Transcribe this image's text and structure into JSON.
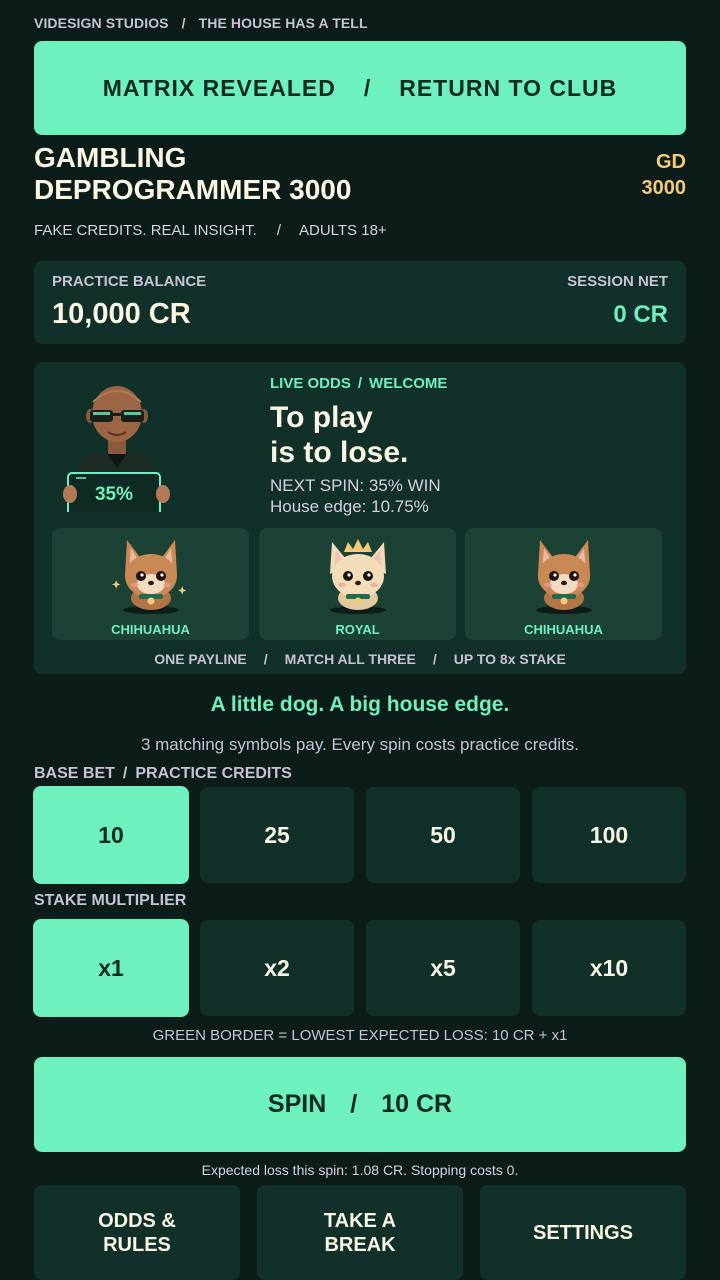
{
  "breadcrumb": {
    "studio": "VIDESIGN STUDIOS",
    "sep": "/",
    "game": "THE HOUSE HAS A TELL"
  },
  "top_button": {
    "left": "MATRIX REVEALED",
    "sep": "/",
    "right": "RETURN TO CLUB"
  },
  "header": {
    "title_line1": "GAMBLING",
    "title_line2": "DEPROGRAMMER 3000",
    "badge_line1": "GD",
    "badge_line2": "3000",
    "sub_left": "FAKE CREDITS. REAL INSIGHT.",
    "sub_sep": "/",
    "sub_right": "ADULTS 18+"
  },
  "balance": {
    "label": "PRACTICE BALANCE",
    "value": "10,000 CR",
    "net_label": "SESSION NET",
    "net_value": "0 CR"
  },
  "dealer": {
    "sign": "35%"
  },
  "odds": {
    "label": "LIVE ODDS",
    "sep": "/",
    "label2": "WELCOME",
    "headline1": "To play",
    "headline2": "is to lose.",
    "next_spin": "NEXT SPIN: 35% WIN",
    "house_edge": "House edge: 10.75%"
  },
  "reels": [
    {
      "label": "CHIHUAHUA",
      "icon": "chihuahua-icon"
    },
    {
      "label": "ROYAL",
      "icon": "royal-chihuahua-icon"
    },
    {
      "label": "CHIHUAHUA",
      "icon": "chihuahua-icon"
    }
  ],
  "payline": {
    "a": "ONE PAYLINE",
    "sep": "/",
    "b": "MATCH ALL THREE",
    "c": "UP TO 8x STAKE"
  },
  "tagline": "A little dog. A big house edge.",
  "explain": "3 matching symbols pay. Every spin costs practice credits.",
  "base_bet": {
    "label": "BASE BET",
    "sep": "/",
    "label2": "PRACTICE CREDITS",
    "options": [
      "10",
      "25",
      "50",
      "100"
    ],
    "selected": "10"
  },
  "multiplier": {
    "label": "STAKE MULTIPLIER",
    "options": [
      "x1",
      "x2",
      "x5",
      "x10"
    ],
    "selected": "x1"
  },
  "green_note": "GREEN BORDER = LOWEST EXPECTED LOSS: 10 CR + x1",
  "spin": {
    "label": "SPIN",
    "sep": "/",
    "cost": "10 CR"
  },
  "expected_note": "Expected loss this spin: 1.08 CR. Stopping costs 0.",
  "bottom": {
    "odds_line1": "ODDS &",
    "odds_line2": "RULES",
    "break_line1": "TAKE A",
    "break_line2": "BREAK",
    "settings": "SETTINGS"
  },
  "colors": {
    "background": "#0c1c18",
    "card": "#113029",
    "accent": "#6ef0bf",
    "gold": "#f2ca7a"
  }
}
